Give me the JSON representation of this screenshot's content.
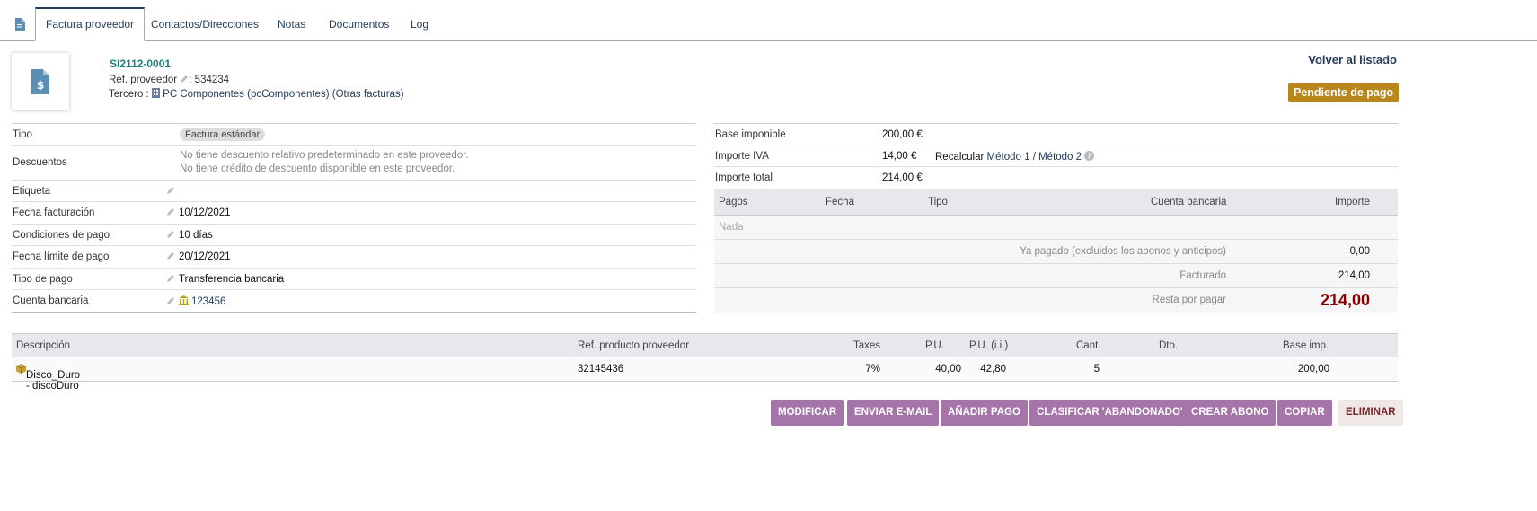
{
  "tabs": [
    {
      "label": "Factura proveedor"
    },
    {
      "label": "Contactos/Direcciones"
    },
    {
      "label": "Notas"
    },
    {
      "label": "Documentos"
    },
    {
      "label": "Log"
    }
  ],
  "header": {
    "ref": "SI2112-0001",
    "ref_supplier_label": "Ref. proveedor",
    "ref_supplier_value": ": 534234",
    "thirdparty_label": "Tercero :",
    "thirdparty_name": "PC Componentes (pcComponentes)",
    "other_invoices": "(Otras facturas)",
    "back_link": "Volver al listado",
    "prev_arrow": "‹",
    "next_arrow": "›",
    "status": "Pendiente de pago"
  },
  "fields": {
    "tipo_label": "Tipo",
    "tipo_value": "Factura estándar",
    "descuentos_label": "Descuentos",
    "descuentos_line1": "No tiene descuento relativo predeterminado en este proveedor.",
    "descuentos_line2": "No tiene crédito de descuento disponible en este proveedor.",
    "etiqueta_label": "Etiqueta",
    "fecha_fact_label": "Fecha facturación",
    "fecha_fact_value": "10/12/2021",
    "condiciones_label": "Condiciones de pago",
    "condiciones_value": "10 días",
    "fecha_limite_label": "Fecha límite de pago",
    "fecha_limite_value": "20/12/2021",
    "tipo_pago_label": "Tipo de pago",
    "tipo_pago_value": "Transferencia bancaria",
    "cuenta_label": "Cuenta bancaria",
    "cuenta_value": "123456"
  },
  "totals": {
    "base_label": "Base imponible",
    "base_value": "200,00 €",
    "iva_label": "Importe IVA",
    "iva_value": "14,00 €",
    "recalc_label": "Recalcular",
    "method1": "Método 1",
    "sep": "/",
    "method2": "Método 2",
    "total_label": "Importe total",
    "total_value": "214,00 €"
  },
  "payments": {
    "headers": {
      "pagos": "Pagos",
      "fecha": "Fecha",
      "tipo": "Tipo",
      "cuenta": "Cuenta bancaria",
      "importe": "Importe"
    },
    "empty": "Nada",
    "paid_label": "Ya pagado (excluidos los abonos y anticipos)",
    "paid_value": "0,00",
    "billed_label": "Facturado",
    "billed_value": "214,00",
    "remain_label": "Resta por pagar",
    "remain_value": "214,00"
  },
  "lines": {
    "headers": {
      "desc": "Descripción",
      "ref": "Ref. producto proveedor",
      "taxes": "Taxes",
      "pu": "P.U.",
      "pu_ii": "P.U. (i.i.)",
      "qty": "Cant.",
      "dto": "Dto.",
      "base": "Base imp."
    },
    "rows": [
      {
        "product": "Disco_Duro - discoDuro",
        "ref": "32145436",
        "taxes": "7%",
        "pu": "40,00",
        "pu_ii": "42,80",
        "qty": "5",
        "dto": "",
        "base": "200,00"
      }
    ]
  },
  "actions": {
    "modify": "MODIFICAR",
    "email": "ENVIAR E-MAIL",
    "add_payment": "AÑADIR PAGO",
    "classify": "CLASIFICAR 'ABANDONADO'",
    "credit": "CREAR ABONO",
    "copy": "COPIAR",
    "delete": "ELIMINAR"
  },
  "colors": {
    "accent": "#263c5c",
    "status": "#b8861b",
    "button": "#a574a9",
    "remain": "#8b0000"
  }
}
